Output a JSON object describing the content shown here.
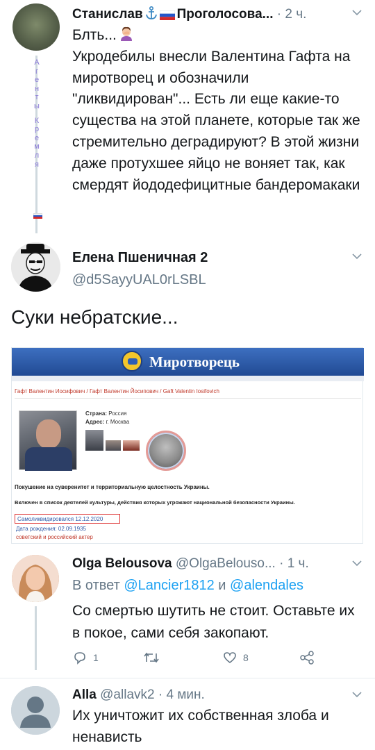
{
  "tweet1": {
    "name": "Станислав",
    "name_suffix": "Проголосова...",
    "time": "2 ч.",
    "lead": "Блть...",
    "text": "Укродебилы внесли Валентина Гафта на миротворец и обозначили \"ликвидирован\"... Есть ли еще какие-то существа на этой планете, которые так же стремительно деградируют? В этой жизни даже протухшее яйцо не воняет так, как смердят йододефицитные бандеромакаки",
    "side_letters": [
      "А",
      "г",
      "е",
      "н",
      "т",
      "ы",
      "К",
      "р",
      "е",
      "м",
      "л",
      "я"
    ]
  },
  "tweet2": {
    "name": "Елена Пшеничная 2",
    "handle": "@d5SayyUAL0rLSBL",
    "text": "Суки небратские..."
  },
  "embed": {
    "site_title": "Миротворець",
    "breadcrumb": "Гафт Валентин Иосифович / Гафт Валентин Йосипович / Gaft Valentin Iosifovich",
    "country_label": "Страна:",
    "country": "Россия",
    "address_label": "Адрес:",
    "address": "г. Москва",
    "crime1": "Покушение на суверенитет и территориальную целостность Украины.",
    "crime2": "Включен в список деятелей культуры, действия которых угрожают национальной безопасности Украины.",
    "status": "Самоликвидировался 12.12.2020",
    "dob": "Дата рождения: 02.09.1935",
    "tag": "советский и российский актер"
  },
  "reply1": {
    "name": "Olga Belousova",
    "handle": "@OlgaBelouso...",
    "time": "1 ч.",
    "reply_prefix": "В ответ",
    "mention1": "@Lancier1812",
    "reply_and": "и",
    "mention2": "@alendales",
    "text": "Со смертью шутить не стоит. Оставьте их в покое, сами себя закопают.",
    "reply_count": "1",
    "retweet_count": "",
    "like_count": "8"
  },
  "reply2": {
    "name": "Alla",
    "handle": "@allavk2",
    "time": "4 мин.",
    "text": "Их уничтожит их собственная злоба и ненависть"
  },
  "colors": {
    "accent": "#1da1f2",
    "secondary_text": "#657786",
    "side_letters": "#8a7ad6"
  }
}
